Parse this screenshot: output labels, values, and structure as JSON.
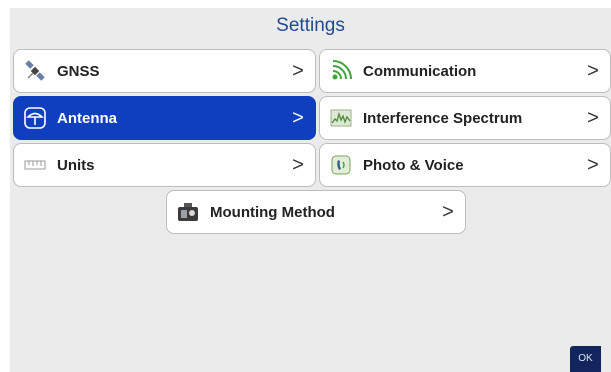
{
  "title": "Settings",
  "items": {
    "gnss": {
      "label": "GNSS",
      "icon": "satellite-icon"
    },
    "communication": {
      "label": "Communication",
      "icon": "wireless-signal-icon"
    },
    "antenna": {
      "label": "Antenna",
      "icon": "antenna-icon"
    },
    "interference": {
      "label": "Interference Spectrum",
      "icon": "spectrum-icon"
    },
    "units": {
      "label": "Units",
      "icon": "ruler-icon"
    },
    "photo_voice": {
      "label": "Photo & Voice",
      "icon": "photo-voice-icon"
    },
    "mounting": {
      "label": "Mounting Method",
      "icon": "mounting-icon"
    }
  },
  "chevron": ">",
  "ok_label": "OK",
  "colors": {
    "title": "#1f4b8f",
    "selected": "#0f3fbf",
    "ok_button": "#12255c",
    "background": "#ebebeb"
  }
}
